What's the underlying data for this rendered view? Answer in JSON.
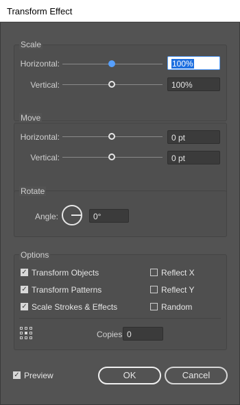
{
  "window": {
    "title": "Transform Effect"
  },
  "scale": {
    "title": "Scale",
    "horizontal_label": "Horizontal:",
    "horizontal_value": "100%",
    "vertical_label": "Vertical:",
    "vertical_value": "100%"
  },
  "move": {
    "title": "Move",
    "horizontal_label": "Horizontal:",
    "horizontal_value": "0 pt",
    "vertical_label": "Vertical:",
    "vertical_value": "0 pt"
  },
  "rotate": {
    "title": "Rotate",
    "angle_label": "Angle:",
    "angle_value": "0°"
  },
  "options": {
    "title": "Options",
    "transform_objects": "Transform Objects",
    "transform_patterns": "Transform Patterns",
    "scale_strokes": "Scale Strokes & Effects",
    "reflect_x": "Reflect X",
    "reflect_y": "Reflect Y",
    "random": "Random",
    "copies_label": "Copies",
    "copies_value": "0"
  },
  "footer": {
    "preview_label": "Preview",
    "ok_label": "OK",
    "cancel_label": "Cancel"
  },
  "colors": {
    "dialog_bg": "#535353",
    "accent": "#56a0ff",
    "selection": "#1d6fe0"
  }
}
